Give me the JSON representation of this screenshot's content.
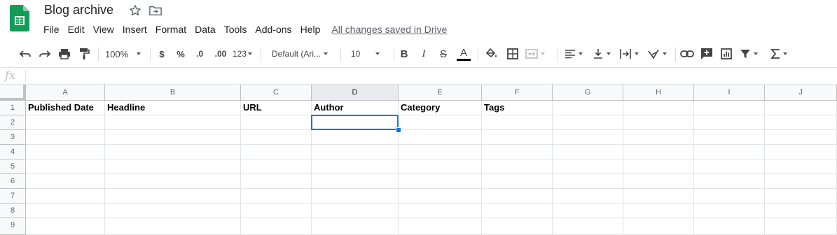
{
  "doc": {
    "title": "Blog archive",
    "saved_status": "All changes saved in Drive",
    "brand_color": "#0f9d58"
  },
  "menu": [
    "File",
    "Edit",
    "View",
    "Insert",
    "Format",
    "Data",
    "Tools",
    "Add-ons",
    "Help"
  ],
  "toolbar": {
    "zoom": "100%",
    "currency": "$",
    "percent": "%",
    "decrease_decimal": ".0",
    "increase_decimal": ".00",
    "more_formats": "123",
    "font": "Default (Ari...",
    "font_size": "10",
    "bold": "B",
    "italic": "I",
    "strikethrough": "S",
    "text_color": "A",
    "text_color_value": "#000000"
  },
  "formula_bar": {
    "fx_label": "fx",
    "value": ""
  },
  "grid": {
    "columns": [
      "A",
      "B",
      "C",
      "D",
      "E",
      "F",
      "G",
      "H",
      "I",
      "J"
    ],
    "rows": [
      "1",
      "2",
      "3",
      "4",
      "5",
      "6",
      "7",
      "8",
      "9"
    ],
    "active_cell": "D2",
    "selection_color": "#1a73e8",
    "header_row": [
      "Published Date",
      "Headline",
      "URL",
      "Author",
      "Category",
      "Tags",
      "",
      "",
      "",
      ""
    ]
  }
}
